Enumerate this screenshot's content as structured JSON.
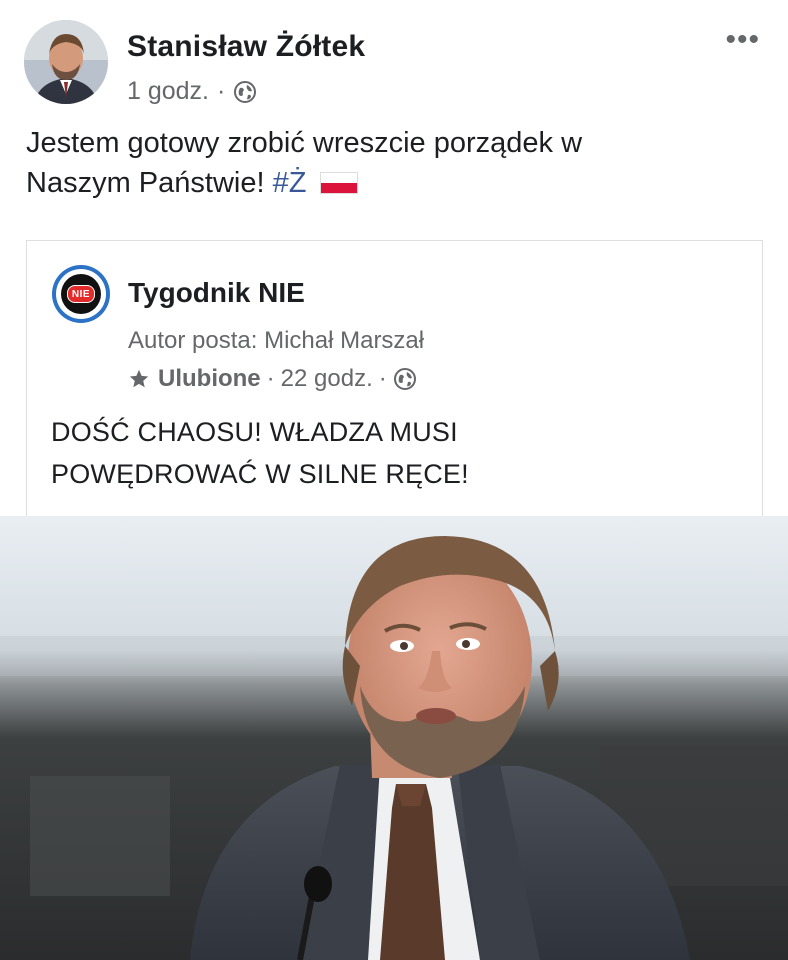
{
  "post": {
    "author_name": "Stanisław Żółtek",
    "timestamp": "1 godz.",
    "separator": "·",
    "privacy_icon": "globe-icon",
    "more_label": "•••",
    "text_line1": "Jestem gotowy zrobić wreszcie porządek w",
    "text_line2_prefix": "Naszym Państwie! ",
    "hashtag": "#Ż",
    "flag_icon": "poland-flag-icon"
  },
  "shared_post": {
    "page_name": "Tygodnik NIE",
    "logo_text": "NIE",
    "author_line": "Autor posta: Michał Marszał",
    "favorite_label": "Ulubione",
    "separator": "·",
    "timestamp": "22 godz.",
    "text_line1": "DOŚĆ CHAOSU! WŁADZA MUSI",
    "text_line2": "POWĘDROWAĆ W SILNE RĘCE!"
  },
  "colors": {
    "text_primary": "#1c1e21",
    "text_secondary": "#65676b",
    "hashtag": "#385898",
    "border": "#dddfe2",
    "logo_blue": "#2c72c6",
    "logo_red": "#e32b2b"
  }
}
